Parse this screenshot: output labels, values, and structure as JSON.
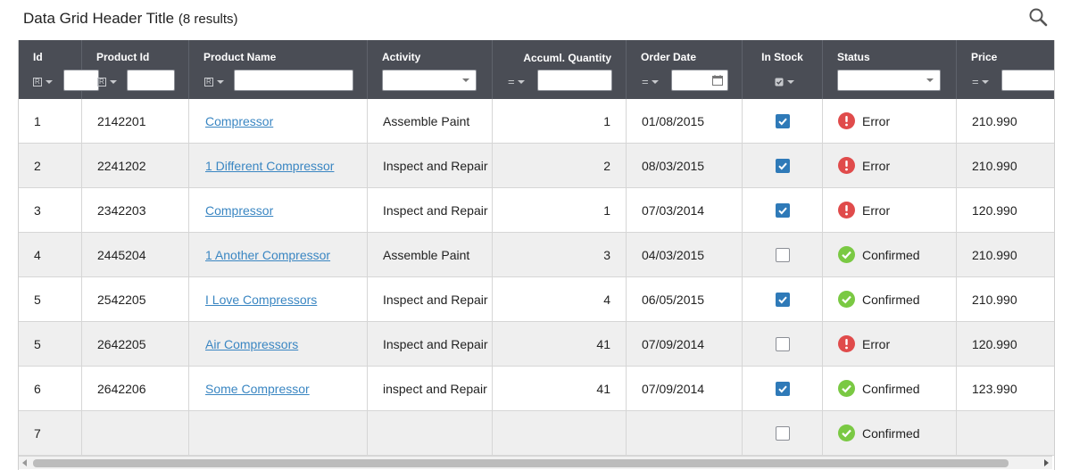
{
  "header": {
    "title": "Data Grid Header Title",
    "count": "(8 results)"
  },
  "columns": [
    {
      "key": "id",
      "label": "Id"
    },
    {
      "key": "product_id",
      "label": "Product Id"
    },
    {
      "key": "product_name",
      "label": "Product Name"
    },
    {
      "key": "activity",
      "label": "Activity"
    },
    {
      "key": "quantity",
      "label": "Accuml. Quantity"
    },
    {
      "key": "order_date",
      "label": "Order Date"
    },
    {
      "key": "in_stock",
      "label": "In Stock"
    },
    {
      "key": "status",
      "label": "Status"
    },
    {
      "key": "price",
      "label": "Price"
    }
  ],
  "rows": [
    {
      "id": "1",
      "product_id": "2142201",
      "product_name": "Compressor",
      "activity": "Assemble Paint",
      "quantity": "1",
      "order_date": "01/08/2015",
      "in_stock": true,
      "status": "Error",
      "price": "210.990"
    },
    {
      "id": "2",
      "product_id": "2241202",
      "product_name": "1 Different Compressor",
      "activity": "Inspect and Repair",
      "quantity": "2",
      "order_date": "08/03/2015",
      "in_stock": true,
      "status": "Error",
      "price": "210.990"
    },
    {
      "id": "3",
      "product_id": "2342203",
      "product_name": "Compressor",
      "activity": "Inspect and Repair",
      "quantity": "1",
      "order_date": "07/03/2014",
      "in_stock": true,
      "status": "Error",
      "price": "120.990"
    },
    {
      "id": "4",
      "product_id": "2445204",
      "product_name": "1 Another Compressor",
      "activity": "Assemble Paint",
      "quantity": "3",
      "order_date": "04/03/2015",
      "in_stock": false,
      "status": "Confirmed",
      "price": "210.990"
    },
    {
      "id": "5",
      "product_id": "2542205",
      "product_name": "I Love Compressors",
      "activity": "Inspect and Repair",
      "quantity": "4",
      "order_date": "06/05/2015",
      "in_stock": true,
      "status": "Confirmed",
      "price": "210.990"
    },
    {
      "id": "5",
      "product_id": "2642205",
      "product_name": "Air Compressors",
      "activity": "Inspect and Repair",
      "quantity": "41",
      "order_date": "07/09/2014",
      "in_stock": false,
      "status": "Error",
      "price": "120.990"
    },
    {
      "id": "6",
      "product_id": "2642206",
      "product_name": "Some Compressor",
      "activity": "inspect and Repair",
      "quantity": "41",
      "order_date": "07/09/2014",
      "in_stock": true,
      "status": "Confirmed",
      "price": "123.990"
    },
    {
      "id": "7",
      "product_id": "",
      "product_name": "",
      "activity": "",
      "quantity": "",
      "order_date": "",
      "in_stock": false,
      "status": "Confirmed",
      "price": ""
    }
  ],
  "colors": {
    "header_bg": "#4a4d55",
    "link": "#3a86c2",
    "checkbox_on": "#2f7ab8",
    "status_error": "#e04b4b",
    "status_confirmed": "#7ac943"
  },
  "icons": {
    "search": "search-icon",
    "calendar": "calendar-icon",
    "error": "exclamation-icon",
    "confirmed": "checkmark-icon"
  }
}
